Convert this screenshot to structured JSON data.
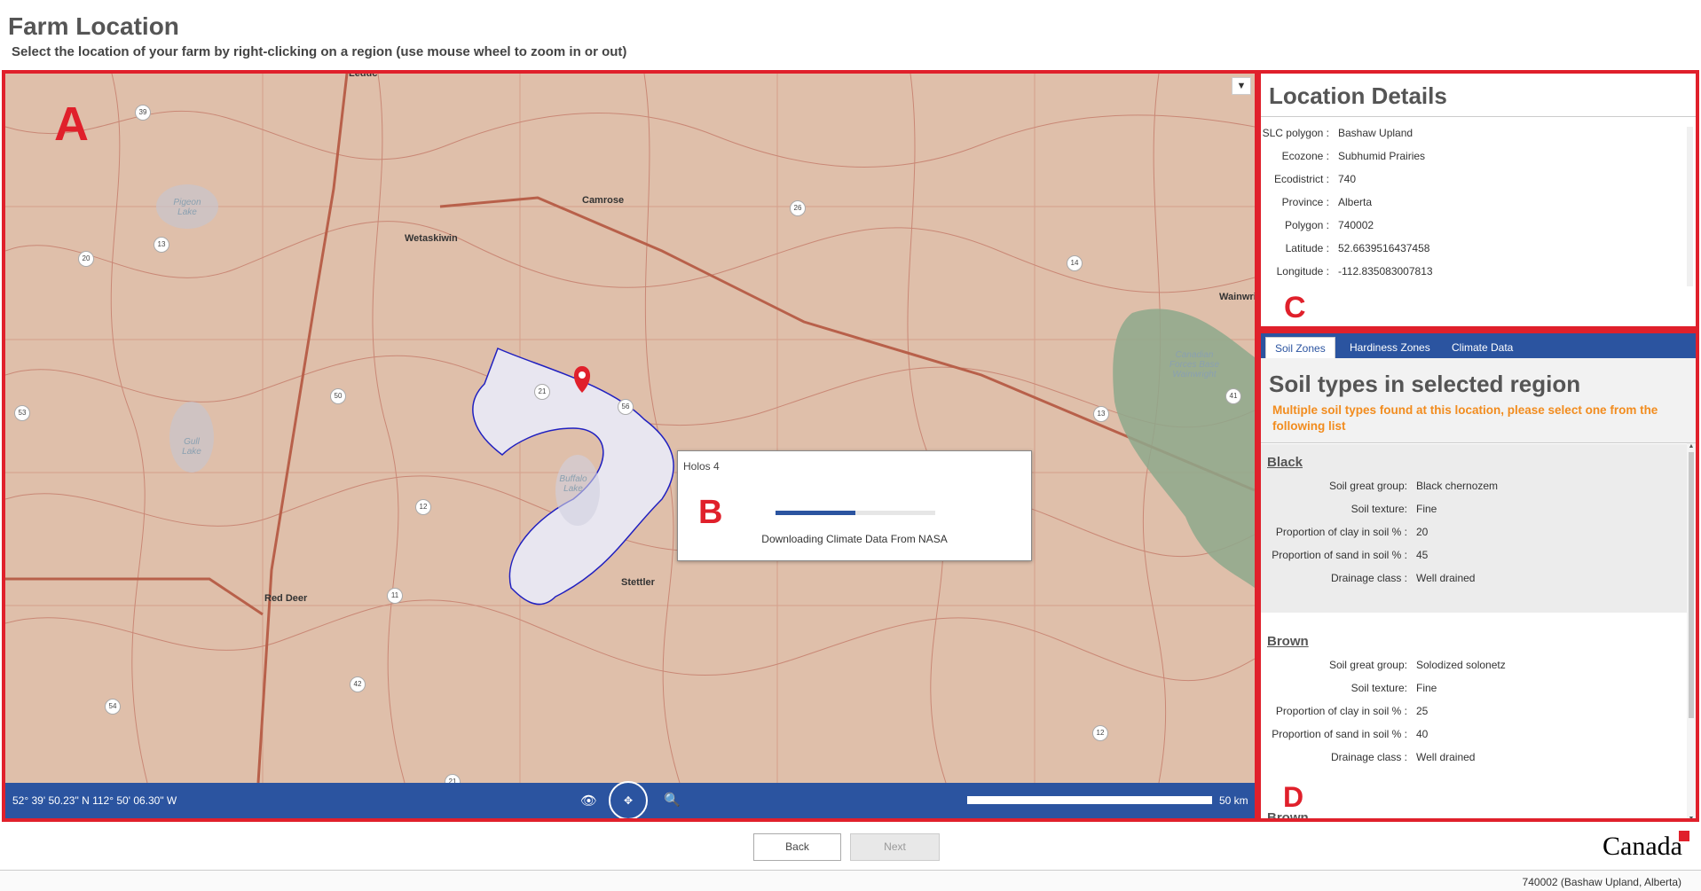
{
  "header": {
    "title": "Farm Location",
    "subtitle": "Select the location of your farm by right-clicking on a region (use mouse wheel to zoom in or out)"
  },
  "annotations": {
    "a": "A",
    "b": "B",
    "c": "C",
    "d": "D"
  },
  "map": {
    "cities": [
      "Leduc",
      "Camrose",
      "Wetaskiwin",
      "Red Deer",
      "Stettler",
      "Wainwri"
    ],
    "lakes": [
      "Pigeon Lake",
      "Gull Lake",
      "Buffalo Lake",
      "Canadian Forces Base Wainwright"
    ],
    "highways": [
      "39",
      "13",
      "20",
      "26",
      "14",
      "21",
      "56",
      "53",
      "50",
      "41",
      "13",
      "12",
      "11",
      "42",
      "54",
      "12",
      "21"
    ],
    "dropdown_icon": "chevron-down-icon",
    "coordinates": "52° 39' 50.23\" N 112° 50' 06.30\" W",
    "scale_label": "50 km"
  },
  "dialog": {
    "title": "Holos 4",
    "message": "Downloading Climate Data From NASA",
    "progress": 0.5
  },
  "location": {
    "title": "Location Details",
    "fields": [
      {
        "label": "SLC polygon :",
        "value": "Bashaw Upland"
      },
      {
        "label": "Ecozone :",
        "value": "Subhumid Prairies"
      },
      {
        "label": "Ecodistrict :",
        "value": "740"
      },
      {
        "label": "Province :",
        "value": "Alberta"
      },
      {
        "label": "Polygon :",
        "value": "740002"
      },
      {
        "label": "Latitude :",
        "value": "52.6639516437458"
      },
      {
        "label": "Longitude :",
        "value": "-112.835083007813"
      }
    ]
  },
  "soil": {
    "tabs": [
      "Soil Zones",
      "Hardiness Zones",
      "Climate Data"
    ],
    "title": "Soil types in selected region",
    "warning": "Multiple soil types found at this location, please select one from the following list",
    "groups": [
      {
        "name": "Black",
        "rows": [
          {
            "label": "Soil great group:",
            "value": "Black chernozem"
          },
          {
            "label": "Soil texture:",
            "value": "Fine"
          },
          {
            "label": "Proportion of clay in soil % :",
            "value": "20"
          },
          {
            "label": "Proportion of sand in soil % :",
            "value": "45"
          },
          {
            "label": "Drainage class :",
            "value": "Well drained"
          }
        ]
      },
      {
        "name": "Brown",
        "rows": [
          {
            "label": "Soil great group:",
            "value": "Solodized solonetz"
          },
          {
            "label": "Soil texture:",
            "value": "Fine"
          },
          {
            "label": "Proportion of clay in soil % :",
            "value": "25"
          },
          {
            "label": "Proportion of sand in soil % :",
            "value": "40"
          },
          {
            "label": "Drainage class :",
            "value": "Well drained"
          }
        ]
      }
    ],
    "cut_text": "Brown"
  },
  "footer": {
    "back": "Back",
    "next": "Next",
    "wordmark": "Canada",
    "status": "740002 (Bashaw Upland, Alberta)"
  },
  "colors": {
    "accent": "#2b54a0",
    "annotation": "#e0202b",
    "warning": "#f28c1e",
    "map_land": "#dfbfaa"
  }
}
